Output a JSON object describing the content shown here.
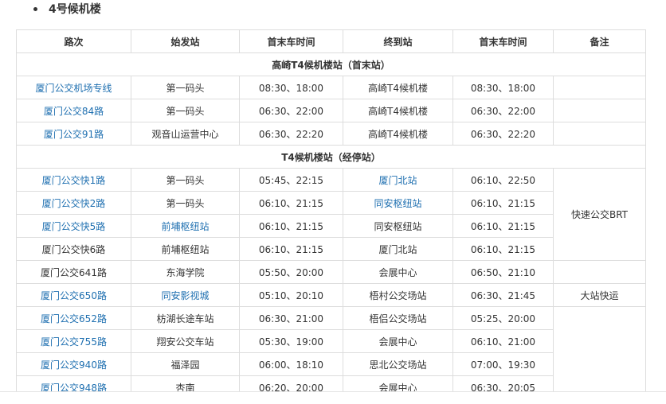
{
  "heading": "4号候机楼",
  "table": {
    "headers": [
      "路次",
      "始发站",
      "首末车时间",
      "终到站",
      "首末车时间",
      "备注"
    ],
    "sections": [
      {
        "title": "高崎T4候机楼站（首末站）",
        "rows": [
          {
            "route": "厦门公交机场专线",
            "route_link": true,
            "origin": "第一码头",
            "origin_link": false,
            "times1": "08:30、18:00",
            "dest": "高崎T4候机楼",
            "dest_link": false,
            "times2": "08:30、18:00"
          },
          {
            "route": "厦门公交84路",
            "route_link": true,
            "origin": "第一码头",
            "origin_link": false,
            "times1": "06:30、22:00",
            "dest": "高崎T4候机楼",
            "dest_link": false,
            "times2": "06:30、22:00"
          },
          {
            "route": "厦门公交91路",
            "route_link": true,
            "origin": "观音山运营中心",
            "origin_link": false,
            "times1": "06:30、22:20",
            "dest": "高崎T4候机楼",
            "dest_link": false,
            "times2": "06:30、22:20"
          }
        ]
      },
      {
        "title": "T4候机楼站（经停站）",
        "rows": [
          {
            "route": "厦门公交快1路",
            "route_link": true,
            "origin": "第一码头",
            "origin_link": false,
            "times1": "05:45、22:15",
            "dest": "厦门北站",
            "dest_link": true,
            "times2": "06:10、22:50"
          },
          {
            "route": "厦门公交快2路",
            "route_link": true,
            "origin": "第一码头",
            "origin_link": false,
            "times1": "06:10、21:15",
            "dest": "同安枢纽站",
            "dest_link": true,
            "times2": "06:10、21:15"
          },
          {
            "route": "厦门公交快5路",
            "route_link": true,
            "origin": "前埔枢纽站",
            "origin_link": true,
            "times1": "06:10、21:15",
            "dest": "同安枢纽站",
            "dest_link": false,
            "times2": "06:10、21:15"
          },
          {
            "route": "厦门公交快6路",
            "route_link": false,
            "origin": "前埔枢纽站",
            "origin_link": false,
            "times1": "06:10、21:15",
            "dest": "厦门北站",
            "dest_link": false,
            "times2": "06:10、21:15"
          },
          {
            "route": "厦门公交641路",
            "route_link": false,
            "origin": "东海学院",
            "origin_link": false,
            "times1": "05:50、20:00",
            "dest": "会展中心",
            "dest_link": false,
            "times2": "06:50、21:10"
          },
          {
            "route": "厦门公交650路",
            "route_link": true,
            "origin": "同安影视城",
            "origin_link": true,
            "times1": "05:10、20:10",
            "dest": "梧村公交场站",
            "dest_link": false,
            "times2": "06:30、21:45"
          },
          {
            "route": "厦门公交652路",
            "route_link": true,
            "origin": "枋湖长途车站",
            "origin_link": false,
            "times1": "06:30、21:00",
            "dest": "梧侣公交场站",
            "dest_link": false,
            "times2": "05:25、20:00"
          },
          {
            "route": "厦门公交755路",
            "route_link": true,
            "origin": "翔安公交车站",
            "origin_link": false,
            "times1": "05:30、19:00",
            "dest": "会展中心",
            "dest_link": false,
            "times2": "06:10、21:00"
          },
          {
            "route": "厦门公交940路",
            "route_link": true,
            "origin": "福泽园",
            "origin_link": false,
            "times1": "06:00、18:10",
            "dest": "思北公交场站",
            "dest_link": false,
            "times2": "07:00、19:30"
          },
          {
            "route": "厦门公交948路",
            "route_link": true,
            "origin": "杏南",
            "origin_link": false,
            "times1": "06:20、20:00",
            "dest": "会展中心",
            "dest_link": false,
            "times2": "06:30、20:05"
          }
        ],
        "notes": [
          {
            "text": "快速公交BRT",
            "rowspan": 4
          },
          {
            "text": "",
            "rowspan": 1
          },
          {
            "text": "大站快运",
            "rowspan": 1
          },
          {
            "text": "",
            "rowspan": 4
          }
        ]
      }
    ]
  }
}
